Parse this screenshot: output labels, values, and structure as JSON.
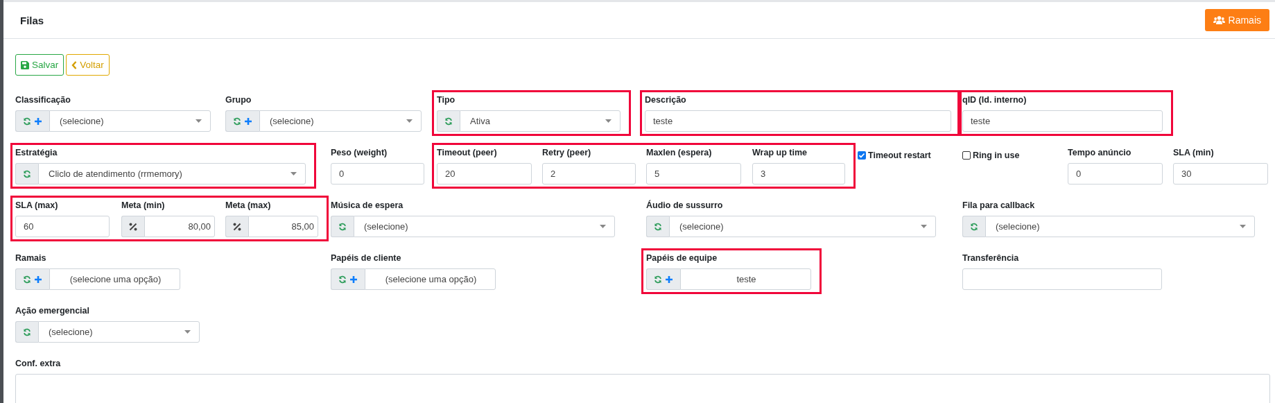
{
  "header": {
    "title": "Filas",
    "ramais_button": "Ramais"
  },
  "actions": [
    {
      "kind": "save",
      "label": "Salvar"
    },
    {
      "kind": "back",
      "label": "Voltar"
    }
  ],
  "rows": [
    [
      {
        "highlighted": false,
        "fields": [
          {
            "kind": "select",
            "label": "Classificação",
            "value": "(selecione)",
            "can_add": true
          },
          {
            "kind": "select",
            "label": "Grupo",
            "value": "(selecione)",
            "can_add": true
          }
        ]
      },
      {
        "highlighted": true,
        "fields": [
          {
            "kind": "select",
            "label": "Tipo",
            "value": "Ativa",
            "can_add": false
          }
        ]
      },
      {
        "highlighted": true,
        "fields": [
          {
            "kind": "input",
            "label": "Descrição",
            "value": "teste"
          }
        ]
      },
      {
        "highlighted": true,
        "fields": [
          {
            "kind": "input",
            "label": "qID (Id. interno)",
            "value": "teste"
          }
        ]
      }
    ],
    [
      {
        "highlighted": true,
        "fields": [
          {
            "kind": "select",
            "label": "Estratégia",
            "value": "Cliclo de atendimento (rrmemory)",
            "can_add": false
          }
        ]
      },
      {
        "highlighted": false,
        "fields": [
          {
            "kind": "input",
            "label": "Peso (weight)",
            "value": "0"
          }
        ]
      },
      {
        "highlighted": true,
        "fields": [
          {
            "kind": "input",
            "label": "Timeout (peer)",
            "value": "20"
          },
          {
            "kind": "input",
            "label": "Retry (peer)",
            "value": "2"
          },
          {
            "kind": "input",
            "label": "Maxlen (espera)",
            "value": "5"
          },
          {
            "kind": "input",
            "label": "Wrap up time",
            "value": "3"
          }
        ]
      },
      {
        "highlighted": false,
        "fields": [
          {
            "kind": "checkbox",
            "label": "Timeout restart",
            "checked": true
          },
          {
            "kind": "checkbox",
            "label": "Ring in use",
            "checked": false
          },
          {
            "kind": "input",
            "label": "Tempo anúncio",
            "value": "0"
          },
          {
            "kind": "input",
            "label": "SLA (min)",
            "value": "30"
          }
        ]
      }
    ],
    [
      {
        "highlighted": true,
        "fields": [
          {
            "kind": "input",
            "label": "SLA (max)",
            "value": "60"
          },
          {
            "kind": "percent",
            "label": "Meta (min)",
            "value": "80,00"
          },
          {
            "kind": "percent",
            "label": "Meta (max)",
            "value": "85,00"
          }
        ]
      },
      {
        "highlighted": false,
        "fields": [
          {
            "kind": "select",
            "label": "Música de espera",
            "value": "(selecione)",
            "can_add": false
          },
          {
            "kind": "select",
            "label": "Áudio de sussurro",
            "value": "(selecione)",
            "can_add": false
          },
          {
            "kind": "select",
            "label": "Fila para callback",
            "value": "(selecione)",
            "can_add": false
          }
        ]
      }
    ],
    [
      {
        "highlighted": false,
        "fields": [
          {
            "kind": "multiselect",
            "label": "Ramais",
            "value": "(selecione uma opção)",
            "can_add": true
          },
          {
            "kind": "multiselect",
            "label": "Papéis de cliente",
            "value": "(selecione uma opção)",
            "can_add": true
          }
        ]
      },
      {
        "highlighted": true,
        "fields": [
          {
            "kind": "multiselect",
            "label": "Papéis de equipe",
            "value": "teste",
            "can_add": true
          }
        ]
      },
      {
        "highlighted": false,
        "fields": [
          {
            "kind": "input",
            "label": "Transferência"
          }
        ]
      }
    ],
    [
      {
        "highlighted": false,
        "fields": [
          {
            "kind": "select",
            "label": "Ação emergencial",
            "value": "(selecione)",
            "can_add": false
          }
        ]
      }
    ],
    [
      {
        "highlighted": false,
        "fields": [
          {
            "kind": "textarea",
            "label": "Conf. extra"
          }
        ]
      }
    ]
  ]
}
